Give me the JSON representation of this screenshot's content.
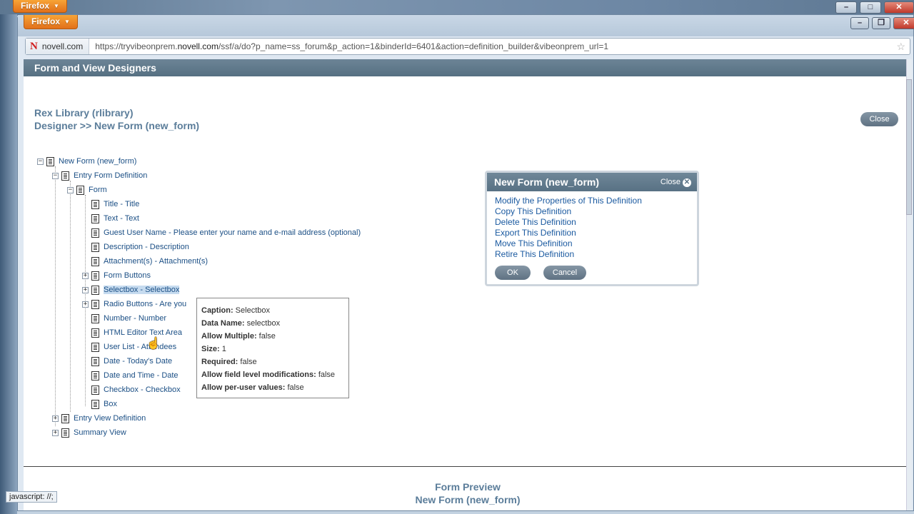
{
  "browser": {
    "outer_button": "Firefox",
    "inner_button": "Firefox",
    "site_identity": "novell.com",
    "url_prefix": "https://tryvibeonprem.",
    "url_domain": "novell.com",
    "url_rest": "/ssf/a/do?p_name=ss_forum&p_action=1&binderId=6401&action=definition_builder&vibeonprem_url=1",
    "status_text": "javascript: //;"
  },
  "page": {
    "header": "Form and View Designers",
    "breadcrumb_line1": "Rex Library (rlibrary)",
    "breadcrumb_line2": "Designer >> New Form (new_form)",
    "close_button": "Close",
    "preview_title": "Form Preview",
    "preview_subtitle": "New Form (new_form)"
  },
  "tree": {
    "root": "New Form (new_form)",
    "entry_form_definition": "Entry Form Definition",
    "form": "Form",
    "items": [
      {
        "label": "Title - Title"
      },
      {
        "label": "Text - Text"
      },
      {
        "label": "Guest User Name - Please enter your name and e-mail address (optional)"
      },
      {
        "label": "Description - Description"
      },
      {
        "label": "Attachment(s) - Attachment(s)"
      },
      {
        "label": "Form Buttons",
        "expandable": true
      },
      {
        "label": "Selectbox - Selectbox",
        "expandable": true,
        "selected": true
      },
      {
        "label": "Radio Buttons - Are you",
        "expandable": true
      },
      {
        "label": "Number - Number"
      },
      {
        "label": "HTML Editor Text Area"
      },
      {
        "label": "User List - Attendees"
      },
      {
        "label": "Date - Today's Date"
      },
      {
        "label": "Date and Time - Date"
      },
      {
        "label": "Checkbox - Checkbox"
      },
      {
        "label": "Box"
      }
    ],
    "entry_view_definition": "Entry View Definition",
    "summary_view": "Summary View"
  },
  "tooltip": {
    "rows": [
      {
        "key": "Caption:",
        "value": "Selectbox"
      },
      {
        "key": "Data Name:",
        "value": "selectbox"
      },
      {
        "key": "Allow Multiple:",
        "value": "false"
      },
      {
        "key": "Size:",
        "value": "1"
      },
      {
        "key": "Required:",
        "value": "false"
      },
      {
        "key": "Allow field level modifications:",
        "value": "false"
      },
      {
        "key": "Allow per-user values:",
        "value": "false"
      }
    ]
  },
  "modal": {
    "title": "New Form (new_form)",
    "close_label": "Close",
    "links": [
      "Modify the Properties of This Definition",
      "Copy This Definition",
      "Delete This Definition",
      "Export This Definition",
      "Move This Definition",
      "Retire This Definition"
    ],
    "ok_label": "OK",
    "cancel_label": "Cancel"
  }
}
